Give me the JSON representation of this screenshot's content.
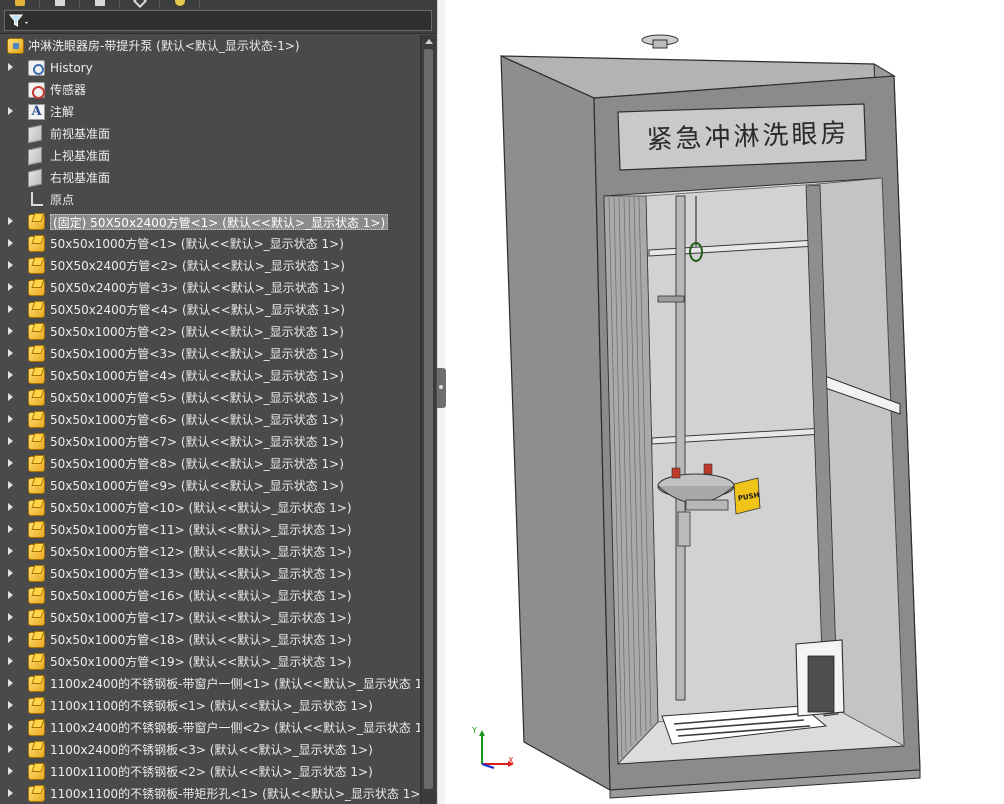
{
  "tree": {
    "root_label": "冲淋洗眼器房-带提升泵  (默认<默认_显示状态-1>)",
    "items": [
      {
        "label": "History",
        "icon": "history-icon",
        "expandable": true
      },
      {
        "label": "传感器",
        "icon": "sensor-icon",
        "expandable": false
      },
      {
        "label": "注解",
        "icon": "annotation-icon",
        "expandable": true
      },
      {
        "label": "前视基准面",
        "icon": "plane-icon",
        "expandable": false
      },
      {
        "label": "上视基准面",
        "icon": "plane-icon",
        "expandable": false
      },
      {
        "label": "右视基准面",
        "icon": "plane-icon",
        "expandable": false
      },
      {
        "label": "原点",
        "icon": "origin-icon",
        "expandable": false
      },
      {
        "label": "(固定) 50X50x2400方管<1> (默认<<默认>_显示状态 1>)",
        "icon": "part-icon",
        "expandable": true,
        "selected": true
      },
      {
        "label": "50x50x1000方管<1> (默认<<默认>_显示状态 1>)",
        "icon": "part-icon",
        "expandable": true
      },
      {
        "label": "50X50x2400方管<2> (默认<<默认>_显示状态 1>)",
        "icon": "part-icon",
        "expandable": true
      },
      {
        "label": "50X50x2400方管<3> (默认<<默认>_显示状态 1>)",
        "icon": "part-icon",
        "expandable": true
      },
      {
        "label": "50X50x2400方管<4> (默认<<默认>_显示状态 1>)",
        "icon": "part-icon",
        "expandable": true
      },
      {
        "label": "50x50x1000方管<2> (默认<<默认>_显示状态 1>)",
        "icon": "part-icon",
        "expandable": true
      },
      {
        "label": "50x50x1000方管<3> (默认<<默认>_显示状态 1>)",
        "icon": "part-icon",
        "expandable": true
      },
      {
        "label": "50x50x1000方管<4> (默认<<默认>_显示状态 1>)",
        "icon": "part-icon",
        "expandable": true
      },
      {
        "label": "50x50x1000方管<5> (默认<<默认>_显示状态 1>)",
        "icon": "part-icon",
        "expandable": true
      },
      {
        "label": "50x50x1000方管<6> (默认<<默认>_显示状态 1>)",
        "icon": "part-icon",
        "expandable": true
      },
      {
        "label": "50x50x1000方管<7> (默认<<默认>_显示状态 1>)",
        "icon": "part-icon",
        "expandable": true
      },
      {
        "label": "50x50x1000方管<8> (默认<<默认>_显示状态 1>)",
        "icon": "part-icon",
        "expandable": true
      },
      {
        "label": "50x50x1000方管<9> (默认<<默认>_显示状态 1>)",
        "icon": "part-icon",
        "expandable": true
      },
      {
        "label": "50x50x1000方管<10> (默认<<默认>_显示状态 1>)",
        "icon": "part-icon",
        "expandable": true
      },
      {
        "label": "50x50x1000方管<11> (默认<<默认>_显示状态 1>)",
        "icon": "part-icon",
        "expandable": true
      },
      {
        "label": "50x50x1000方管<12> (默认<<默认>_显示状态 1>)",
        "icon": "part-icon",
        "expandable": true
      },
      {
        "label": "50x50x1000方管<13> (默认<<默认>_显示状态 1>)",
        "icon": "part-icon",
        "expandable": true
      },
      {
        "label": "50x50x1000方管<16> (默认<<默认>_显示状态 1>)",
        "icon": "part-icon",
        "expandable": true
      },
      {
        "label": "50x50x1000方管<17> (默认<<默认>_显示状态 1>)",
        "icon": "part-icon",
        "expandable": true
      },
      {
        "label": "50x50x1000方管<18> (默认<<默认>_显示状态 1>)",
        "icon": "part-icon",
        "expandable": true
      },
      {
        "label": "50x50x1000方管<19> (默认<<默认>_显示状态 1>)",
        "icon": "part-icon",
        "expandable": true
      },
      {
        "label": "1100x2400的不锈钢板-带窗户一侧<1> (默认<<默认>_显示状态 1>)",
        "icon": "part-icon",
        "expandable": true
      },
      {
        "label": "1100x1100的不锈钢板<1> (默认<<默认>_显示状态 1>)",
        "icon": "part-icon",
        "expandable": true
      },
      {
        "label": "1100x2400的不锈钢板-带窗户一侧<2> (默认<<默认>_显示状态 1>)",
        "icon": "part-icon",
        "expandable": true
      },
      {
        "label": "1100x2400的不锈钢板<3> (默认<<默认>_显示状态 1>)",
        "icon": "part-icon",
        "expandable": true
      },
      {
        "label": "1100x1100的不锈钢板<2> (默认<<默认>_显示状态 1>)",
        "icon": "part-icon",
        "expandable": true
      },
      {
        "label": "1100x1100的不锈钢板-带矩形孔<1> (默认<<默认>_显示状态 1>)",
        "icon": "part-icon",
        "expandable": true
      }
    ]
  },
  "viewport": {
    "sign_text": "紧急冲淋洗眼房",
    "push_label": "PUSH",
    "triad": {
      "x": "X",
      "y": "Y"
    }
  },
  "colors": {
    "panel_bg": "#4a4a4a",
    "panel_text": "#ececec",
    "selection": "#8c8c8c",
    "frame_gray": "#8d8d8d",
    "triad_x": "#d81e1e",
    "triad_y": "#1a9a1a",
    "triad_z": "#1e2fd8"
  }
}
